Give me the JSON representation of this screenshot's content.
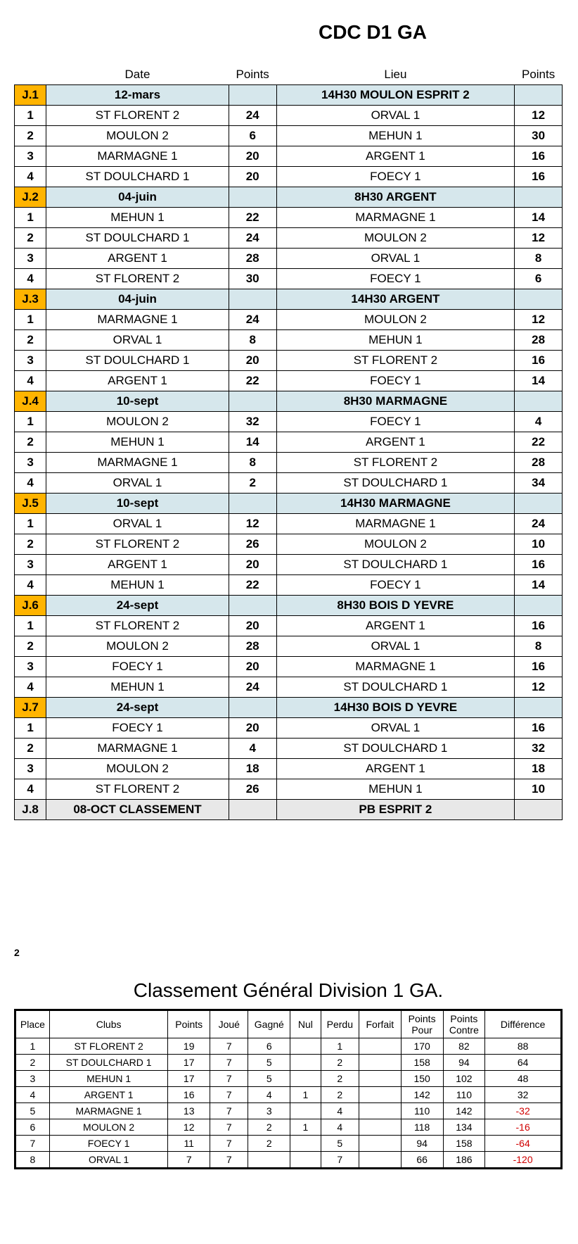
{
  "main_title": "CDC  D1 GA",
  "sched_headers": {
    "c2": "Date",
    "c3": "Points",
    "c4": "Lieu",
    "c5": "Points"
  },
  "rounds": [
    {
      "j": "J.1",
      "date": "12-mars",
      "lieu": "14H30 MOULON ESPRIT 2",
      "matches": [
        {
          "n": "1",
          "h": "ST FLORENT 2",
          "hp": "24",
          "a": "ORVAL 1",
          "ap": "12"
        },
        {
          "n": "2",
          "h": "MOULON 2",
          "hp": "6",
          "a": "MEHUN 1",
          "ap": "30"
        },
        {
          "n": "3",
          "h": "MARMAGNE 1",
          "hp": "20",
          "a": "ARGENT 1",
          "ap": "16"
        },
        {
          "n": "4",
          "h": "ST DOULCHARD 1",
          "hp": "20",
          "a": "FOECY 1",
          "ap": "16"
        }
      ]
    },
    {
      "j": "J.2",
      "date": "04-juin",
      "lieu": "8H30 ARGENT",
      "matches": [
        {
          "n": "1",
          "h": "MEHUN 1",
          "hp": "22",
          "a": "MARMAGNE 1",
          "ap": "14"
        },
        {
          "n": "2",
          "h": "ST DOULCHARD 1",
          "hp": "24",
          "a": "MOULON 2",
          "ap": "12"
        },
        {
          "n": "3",
          "h": "ARGENT 1",
          "hp": "28",
          "a": "ORVAL 1",
          "ap": "8"
        },
        {
          "n": "4",
          "h": "ST FLORENT 2",
          "hp": "30",
          "a": "FOECY 1",
          "ap": "6"
        }
      ]
    },
    {
      "j": "J.3",
      "date": "04-juin",
      "lieu": "14H30 ARGENT",
      "matches": [
        {
          "n": "1",
          "h": "MARMAGNE 1",
          "hp": "24",
          "a": "MOULON 2",
          "ap": "12"
        },
        {
          "n": "2",
          "h": "ORVAL 1",
          "hp": "8",
          "a": "MEHUN 1",
          "ap": "28"
        },
        {
          "n": "3",
          "h": "ST DOULCHARD 1",
          "hp": "20",
          "a": "ST FLORENT 2",
          "ap": "16"
        },
        {
          "n": "4",
          "h": "ARGENT 1",
          "hp": "22",
          "a": "FOECY 1",
          "ap": "14"
        }
      ]
    },
    {
      "j": "J.4",
      "date": "10-sept",
      "lieu": "8H30  MARMAGNE",
      "matches": [
        {
          "n": "1",
          "h": "MOULON 2",
          "hp": "32",
          "a": "FOECY 1",
          "ap": "4"
        },
        {
          "n": "2",
          "h": "MEHUN 1",
          "hp": "14",
          "a": "ARGENT 1",
          "ap": "22"
        },
        {
          "n": "3",
          "h": "MARMAGNE 1",
          "hp": "8",
          "a": "ST FLORENT 2",
          "ap": "28"
        },
        {
          "n": "4",
          "h": "ORVAL 1",
          "hp": "2",
          "a": "ST DOULCHARD 1",
          "ap": "34"
        }
      ]
    },
    {
      "j": "J.5",
      "date": "10-sept",
      "lieu": "14H30  MARMAGNE",
      "matches": [
        {
          "n": "1",
          "h": "ORVAL 1",
          "hp": "12",
          "a": "MARMAGNE 1",
          "ap": "24"
        },
        {
          "n": "2",
          "h": "ST FLORENT 2",
          "hp": "26",
          "a": "MOULON 2",
          "ap": "10"
        },
        {
          "n": "3",
          "h": "ARGENT 1",
          "hp": "20",
          "a": "ST DOULCHARD 1",
          "ap": "16"
        },
        {
          "n": "4",
          "h": "MEHUN 1",
          "hp": "22",
          "a": "FOECY 1",
          "ap": "14"
        }
      ]
    },
    {
      "j": "J.6",
      "date": "24-sept",
      "lieu": "8H30  BOIS D YEVRE",
      "matches": [
        {
          "n": "1",
          "h": "ST FLORENT 2",
          "hp": "20",
          "a": "ARGENT 1",
          "ap": "16"
        },
        {
          "n": "2",
          "h": "MOULON 2",
          "hp": "28",
          "a": "ORVAL 1",
          "ap": "8"
        },
        {
          "n": "3",
          "h": "FOECY 1",
          "hp": "20",
          "a": "MARMAGNE 1",
          "ap": "16"
        },
        {
          "n": "4",
          "h": "MEHUN 1",
          "hp": "24",
          "a": "ST DOULCHARD 1",
          "ap": "12"
        }
      ]
    },
    {
      "j": "J.7",
      "date": "24-sept",
      "lieu": "14H30  BOIS D YEVRE",
      "matches": [
        {
          "n": "1",
          "h": "FOECY 1",
          "hp": "20",
          "a": "ORVAL 1",
          "ap": "16"
        },
        {
          "n": "2",
          "h": "MARMAGNE 1",
          "hp": "4",
          "a": "ST DOULCHARD 1",
          "ap": "32"
        },
        {
          "n": "3",
          "h": "MOULON 2",
          "hp": "18",
          "a": "ARGENT 1",
          "ap": "18"
        },
        {
          "n": "4",
          "h": "ST FLORENT 2",
          "hp": "26",
          "a": "MEHUN 1",
          "ap": "10"
        }
      ]
    }
  ],
  "final_row": {
    "j": "J.8",
    "date": "08-OCT CLASSEMENT",
    "lieu": "PB ESPRIT 2"
  },
  "page_number": "2",
  "rank_title": "Classement Général Division 1 GA.",
  "rank_headers": {
    "place": "Place",
    "clubs": "Clubs",
    "points": "Points",
    "joue": "Joué",
    "gagne": "Gagné",
    "nul": "Nul",
    "perdu": "Perdu",
    "forfait": "Forfait",
    "pour": "Points Pour",
    "contre": "Points Contre",
    "diff": "Différence"
  },
  "ranking": [
    {
      "place": "1",
      "club": "ST FLORENT 2",
      "pts": "19",
      "j": "7",
      "g": "6",
      "n": "",
      "p": "1",
      "f": "",
      "pour": "170",
      "contre": "82",
      "diff": "88",
      "neg": false
    },
    {
      "place": "2",
      "club": "ST DOULCHARD 1",
      "pts": "17",
      "j": "7",
      "g": "5",
      "n": "",
      "p": "2",
      "f": "",
      "pour": "158",
      "contre": "94",
      "diff": "64",
      "neg": false
    },
    {
      "place": "3",
      "club": "MEHUN 1",
      "pts": "17",
      "j": "7",
      "g": "5",
      "n": "",
      "p": "2",
      "f": "",
      "pour": "150",
      "contre": "102",
      "diff": "48",
      "neg": false
    },
    {
      "place": "4",
      "club": "ARGENT 1",
      "pts": "16",
      "j": "7",
      "g": "4",
      "n": "1",
      "p": "2",
      "f": "",
      "pour": "142",
      "contre": "110",
      "diff": "32",
      "neg": false
    },
    {
      "place": "5",
      "club": "MARMAGNE 1",
      "pts": "13",
      "j": "7",
      "g": "3",
      "n": "",
      "p": "4",
      "f": "",
      "pour": "110",
      "contre": "142",
      "diff": "-32",
      "neg": true
    },
    {
      "place": "6",
      "club": "MOULON 2",
      "pts": "12",
      "j": "7",
      "g": "2",
      "n": "1",
      "p": "4",
      "f": "",
      "pour": "118",
      "contre": "134",
      "diff": "-16",
      "neg": true
    },
    {
      "place": "7",
      "club": "FOECY 1",
      "pts": "11",
      "j": "7",
      "g": "2",
      "n": "",
      "p": "5",
      "f": "",
      "pour": "94",
      "contre": "158",
      "diff": "-64",
      "neg": true
    },
    {
      "place": "8",
      "club": "ORVAL 1",
      "pts": "7",
      "j": "7",
      "g": "",
      "n": "",
      "p": "7",
      "f": "",
      "pour": "66",
      "contre": "186",
      "diff": "-120",
      "neg": true
    }
  ]
}
